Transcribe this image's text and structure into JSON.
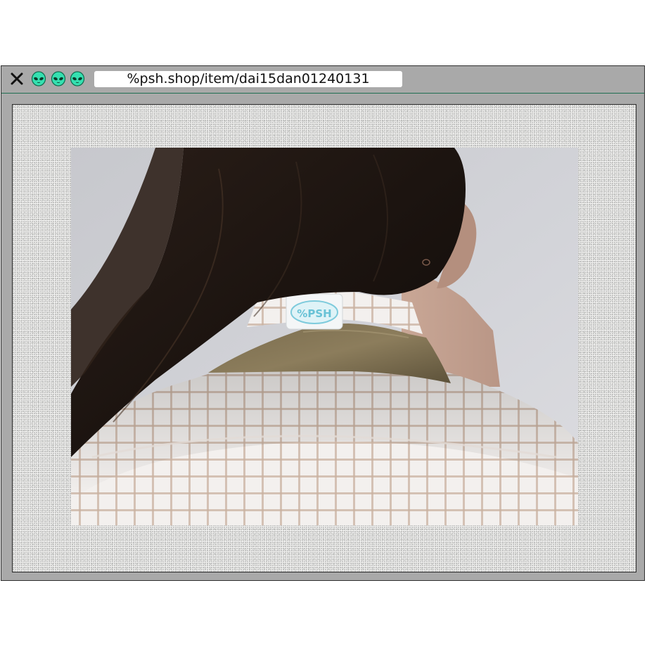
{
  "browser": {
    "url": "%psh.shop/item/dai15dan01240131",
    "controls": [
      "close-icon",
      "alien-icon",
      "alien-icon",
      "alien-icon"
    ],
    "accent_color": "#35e0b0"
  },
  "content": {
    "image": "product-photo",
    "label_logo_text": "%PSH"
  }
}
